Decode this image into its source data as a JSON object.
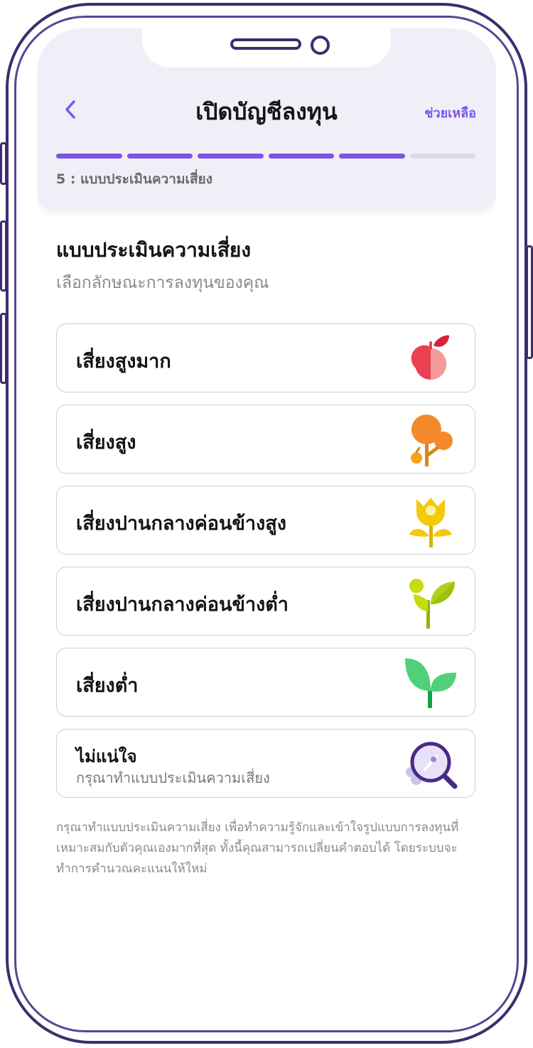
{
  "header": {
    "title": "เปิดบัญชีลงทุน",
    "help_label": "ช่วยเหลือ",
    "progress": {
      "current_step": 5,
      "total_steps": 6
    },
    "step_label": "5 : แบบประเมินความเสี่ยง"
  },
  "content": {
    "title": "แบบประเมินความเสี่ยง",
    "subtitle": "เลือกลักษณะการลงทุนของคุณ"
  },
  "options": [
    {
      "label": "เสี่ยงสูงมาก",
      "icon": "apple-icon"
    },
    {
      "label": "เสี่ยงสูง",
      "icon": "orange-tree-icon"
    },
    {
      "label": "เสี่ยงปานกลางค่อนข้างสูง",
      "icon": "yellow-flower-icon"
    },
    {
      "label": "เสี่ยงปานกลางค่อนข้างต่ำ",
      "icon": "sprout-icon"
    },
    {
      "label": "เสี่ยงต่ำ",
      "icon": "seedling-icon"
    },
    {
      "label": "ไม่แน่ใจ",
      "sublabel": "กรุณาทำแบบประเมินความเสี่ยง",
      "icon": "magnifier-icon"
    }
  ],
  "footnote": "กรุณาทำแบบประเมินความเสี่ยง เพื่อทำความรู้จักและเข้าใจรูปแบบการลงทุนที่เหมาะสมกับตัวคุณเองมากที่สุด ทั้งนี้คุณสามารถเปลี่ยนคำตอบได้ โดยระบบจะทำการคำนวณคะแนนให้ใหม่",
  "colors": {
    "accent": "#7b55e6",
    "header_bg": "#f0eef7",
    "frame": "#3e2d6e"
  }
}
